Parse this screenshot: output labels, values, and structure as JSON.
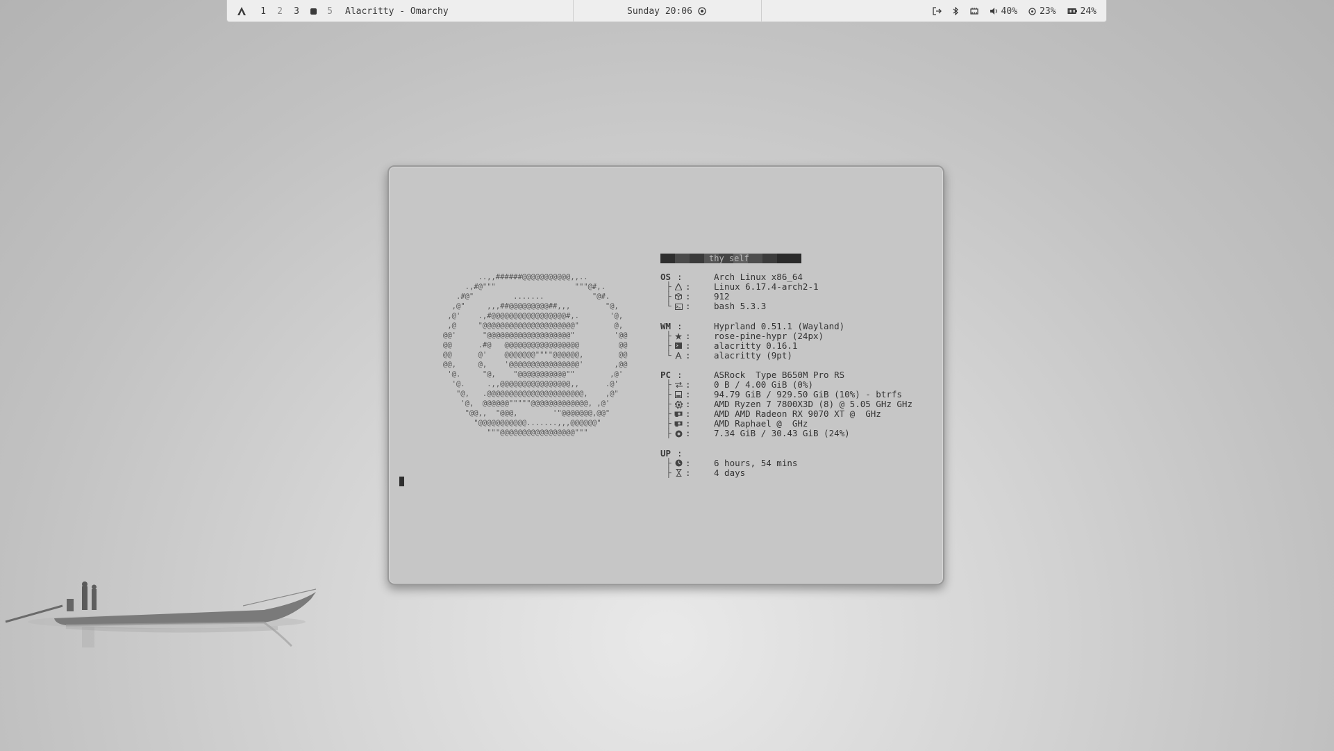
{
  "bar": {
    "workspaces": [
      {
        "label": "1",
        "active": false
      },
      {
        "label": "2",
        "active": false,
        "dim": true
      },
      {
        "label": "3",
        "active": false
      },
      {
        "label": "",
        "active": true
      },
      {
        "label": "5",
        "active": false,
        "dim": true
      }
    ],
    "window_title": "Alacritty - Omarchy",
    "clock": "Sunday 20:06",
    "status": {
      "volume": "40%",
      "cpu": "23%",
      "battery": "24%"
    },
    "icons": [
      "omarchy-logo-icon",
      "logout-icon",
      "bluetooth-icon",
      "network-icon",
      "volume-icon",
      "cpu-icon",
      "battery-icon",
      "screen-record-icon"
    ]
  },
  "terminal": {
    "ascii_art": "        ..,,######@@@@@@@@@@@,,..\n     .,#@\"\"\"                  \"\"\"@#,.\n   .#@\"         .......           \"@#.\n  ,@\"     ,,,##@@@@@@@@@##,,,        \"@,\n ,@'    .,#@@@@@@@@@@@@@@@@@#,.       '@,\n ,@     \"@@@@@@@@@@@@@@@@@@@@@\"        @,\n@@'      \"@@@@@@@@@@@@@@@@@@@\"         '@@\n@@      .#@   @@@@@@@@@@@@@@@@@         @@\n@@      @'    @@@@@@@\"\"\"\"@@@@@@,        @@\n@@,     @,    '@@@@@@@@@@@@@@@@'       ,@@\n '@.     \"@,    \"@@@@@@@@@@@\"\"        ,@'\n  '@.     .,,@@@@@@@@@@@@@@@@,,      .@'\n   \"@,   .@@@@@@@@@@@@@@@@@@@@@@,    ,@\"\n    '@,  @@@@@@\"\"\"\"\"@@@@@@@@@@@@@, ,@'\n     \"@@,,  \"@@@,        '\"@@@@@@@,@@\"\n       \"@@@@@@@@@@@.......,,,@@@@@@\"\n          \"\"\"@@@@@@@@@@@@@@@@@\"\"\"",
    "banner": "thy  self",
    "sections": [
      {
        "key": "OS",
        "rows": [
          {
            "tree": "",
            "icon": "",
            "value": "Arch Linux x86_64"
          },
          {
            "tree": "├",
            "icon": "arch-icon",
            "value": "Linux 6.17.4-arch2-1"
          },
          {
            "tree": "├",
            "icon": "package-icon",
            "value": "912"
          },
          {
            "tree": "└",
            "icon": "shell-icon",
            "value": "bash 5.3.3"
          }
        ]
      },
      {
        "key": "WM",
        "rows": [
          {
            "tree": "",
            "icon": "",
            "value": "Hyprland 0.51.1 (Wayland)"
          },
          {
            "tree": "├",
            "icon": "star-icon",
            "value": "rose-pine-hypr (24px)"
          },
          {
            "tree": "├",
            "icon": "terminal-icon",
            "value": "alacritty 0.16.1"
          },
          {
            "tree": "└",
            "icon": "font-icon",
            "value": "alacritty (9pt)"
          }
        ]
      },
      {
        "key": "PC",
        "rows": [
          {
            "tree": "",
            "icon": "",
            "value": "ASRock  Type B650M Pro RS"
          },
          {
            "tree": "├",
            "icon": "swap-icon",
            "value": "0 B / 4.00 GiB (0%)"
          },
          {
            "tree": "├",
            "icon": "disk-icon",
            "value": "94.79 GiB / 929.50 GiB (10%) - btrfs"
          },
          {
            "tree": "├",
            "icon": "cpu-chip-icon",
            "value": "AMD Ryzen 7 7800X3D (8) @ 5.05 GHz GHz"
          },
          {
            "tree": "├",
            "icon": "gpu-icon",
            "value": "AMD AMD Radeon RX 9070 XT @  GHz"
          },
          {
            "tree": "├",
            "icon": "gpu-icon",
            "value": "AMD Raphael @  GHz"
          },
          {
            "tree": "├",
            "icon": "memory-icon",
            "value": "7.34 GiB / 30.43 GiB (24%)"
          }
        ]
      },
      {
        "key": "UP",
        "rows": [
          {
            "tree": "",
            "icon": "",
            "value": ""
          },
          {
            "tree": "├",
            "icon": "uptime-icon",
            "value": "6 hours, 54 mins"
          },
          {
            "tree": "├",
            "icon": "hourglass-icon",
            "value": "4 days"
          }
        ]
      }
    ]
  }
}
